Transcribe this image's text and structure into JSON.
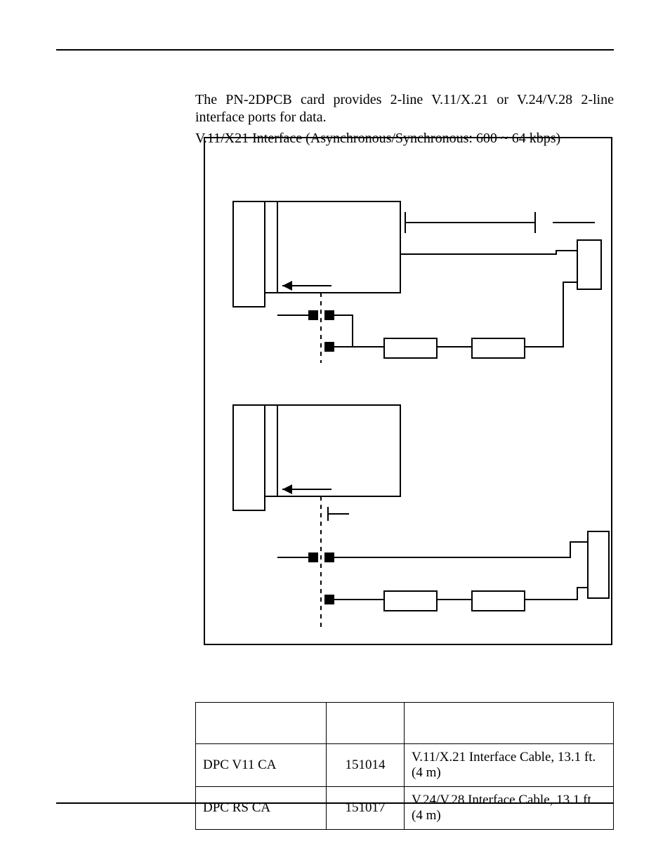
{
  "paragraph1": "The PN-2DPCB card provides 2-line V.11/X.21 or V.24/V.28 2-line interface ports for data.",
  "paragraph2": "V.11/X21 Interface (Asynchronous/Synchronous: 600 ~ 64 kbps)",
  "table": {
    "headers": [
      "",
      "",
      ""
    ],
    "rows": [
      {
        "name": "DPC V11 CA",
        "cat": "151014",
        "desc": "V.11/X.21 Interface Cable, 13.1 ft. (4 m)"
      },
      {
        "name": "DPC RS CA",
        "cat": "151017",
        "desc": "V.24/V.28 Interface Cable, 13.1 ft. (4 m)"
      }
    ]
  }
}
